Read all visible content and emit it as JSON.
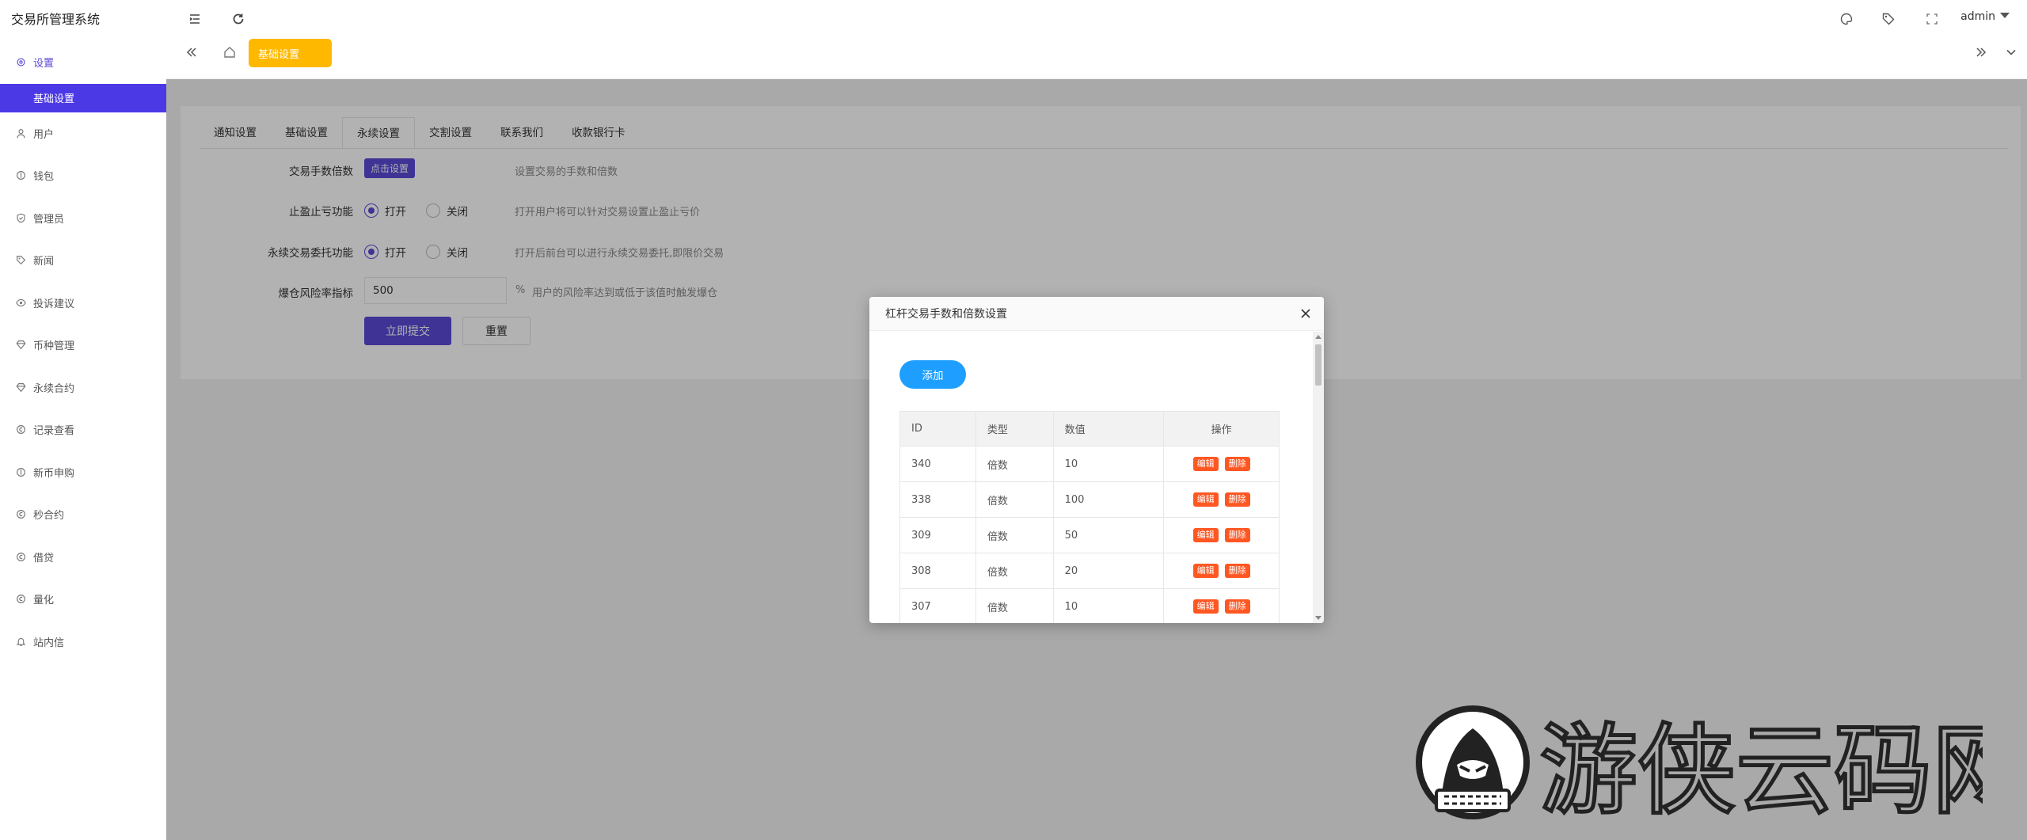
{
  "app": {
    "title": "交易所管理系统"
  },
  "sidebar": {
    "items": [
      {
        "label": "设置",
        "icon": "gear-icon"
      },
      {
        "label": "用户",
        "icon": "user-icon"
      },
      {
        "label": "钱包",
        "icon": "wallet-icon"
      },
      {
        "label": "管理员",
        "icon": "shield-icon"
      },
      {
        "label": "新闻",
        "icon": "tag-icon"
      },
      {
        "label": "投诉建议",
        "icon": "eye-icon"
      },
      {
        "label": "币种管理",
        "icon": "diamond-icon"
      },
      {
        "label": "永续合约",
        "icon": "diamond-icon"
      },
      {
        "label": "记录查看",
        "icon": "circle-c-icon"
      },
      {
        "label": "新币申购",
        "icon": "circle-dollar-icon"
      },
      {
        "label": "秒合约",
        "icon": "circle-c-icon"
      },
      {
        "label": "借贷",
        "icon": "circle-c-icon"
      },
      {
        "label": "量化",
        "icon": "circle-c-icon"
      },
      {
        "label": "站内信",
        "icon": "bell-icon"
      }
    ],
    "active_sub": "基础设置"
  },
  "header": {
    "user": "admin",
    "open_tab": "基础设置"
  },
  "settings": {
    "tabs": [
      "通知设置",
      "基础设置",
      "永续设置",
      "交割设置",
      "联系我们",
      "收款银行卡"
    ],
    "active_tab": 2,
    "rows": {
      "fee_label": "交易手数倍数",
      "fee_button": "点击设置",
      "fee_hint": "设置交易的手数和倍数",
      "stop_label": "止盈止亏功能",
      "stop_on": "打开",
      "stop_off": "关闭",
      "stop_hint": "打开用户将可以针对交易设置止盈止亏价",
      "entrust_label": "永续交易委托功能",
      "entrust_on": "打开",
      "entrust_off": "关闭",
      "entrust_hint": "打开后前台可以进行永续交易委托,即限价交易",
      "risk_label": "爆仓风险率指标",
      "risk_value": "500",
      "risk_unit": "%",
      "risk_hint": "用户的风险率达到或低于该值时触发爆仓",
      "submit": "立即提交",
      "reset": "重置"
    }
  },
  "modal": {
    "title": "杠杆交易手数和倍数设置",
    "add": "添加",
    "columns": [
      "ID",
      "类型",
      "数值",
      "操作"
    ],
    "rows": [
      {
        "id": "340",
        "type": "倍数",
        "value": "10"
      },
      {
        "id": "338",
        "type": "倍数",
        "value": "100"
      },
      {
        "id": "309",
        "type": "倍数",
        "value": "50"
      },
      {
        "id": "308",
        "type": "倍数",
        "value": "20"
      },
      {
        "id": "307",
        "type": "倍数",
        "value": "10"
      }
    ],
    "edit": "编辑",
    "delete": "删除"
  },
  "watermark": {
    "text": "游侠云码网"
  }
}
